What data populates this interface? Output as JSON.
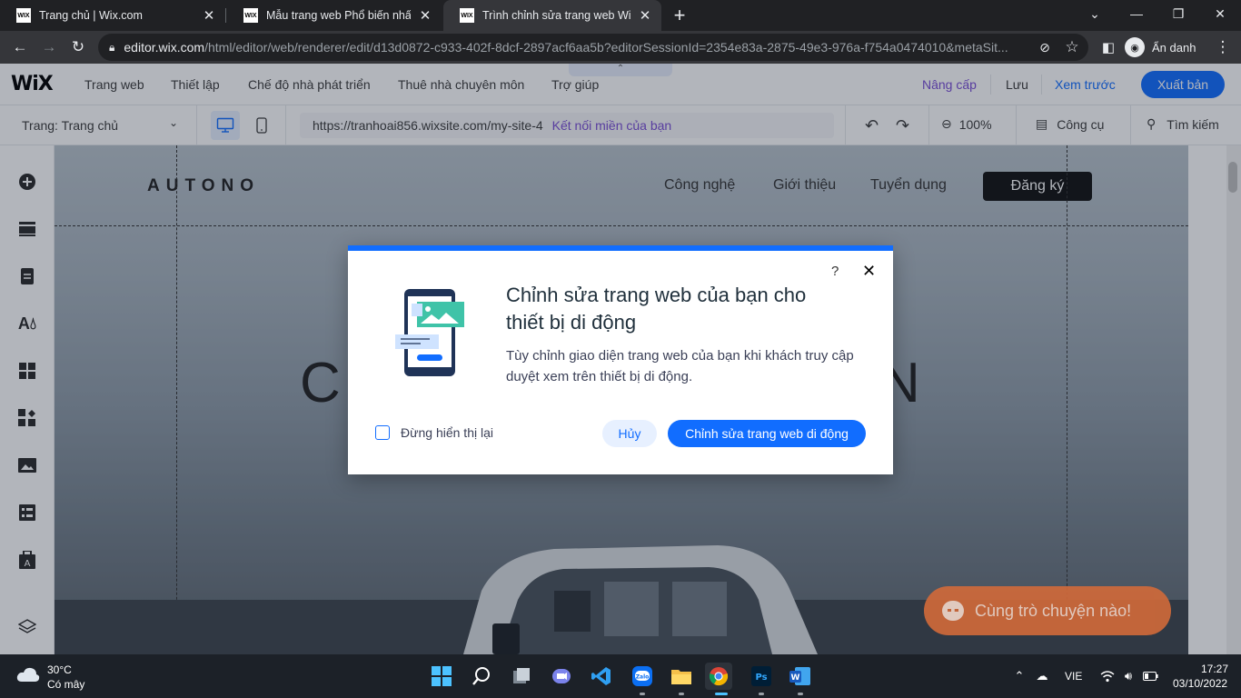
{
  "browser": {
    "tabs": [
      {
        "title": "Trang chủ | Wix.com",
        "active": false
      },
      {
        "title": "Mẫu trang web Phổ biến nhất | W",
        "active": false
      },
      {
        "title": "Trình chỉnh sửa trang web Wix | r",
        "active": true
      }
    ],
    "favicon_text": "WIX",
    "url_host": "editor.wix.com",
    "url_path": "/html/editor/web/renderer/edit/d13d0872-c933-402f-8dcf-2897acf6aa5b?editorSessionId=2354e83a-2875-49e3-976a-f754a0474010&metaSit...",
    "incognito_label": "Ẩn danh"
  },
  "wix": {
    "logo": "WiX",
    "menu": [
      "Trang web",
      "Thiết lập",
      "Chế độ nhà phát triển",
      "Thuê nhà chuyên môn",
      "Trợ giúp"
    ],
    "upgrade": "Nâng cấp",
    "save": "Lưu",
    "preview": "Xem trước",
    "publish": "Xuất bản",
    "page_select": "Trang: Trang chủ",
    "site_url": "https://tranhoai856.wixsite.com/my-site-4",
    "connect_domain": "Kết nối miền của bạn",
    "zoom": "100%",
    "tools": "Công cụ",
    "search": "Tìm kiếm"
  },
  "site": {
    "logo": "AUTONO",
    "nav": [
      "Công nghệ",
      "Giới thiệu",
      "Tuyển dụng"
    ],
    "signup": "Đăng ký",
    "hero_left": "C",
    "hero_right": "N",
    "chat": "Cùng trò chuyện nào!"
  },
  "modal": {
    "help": "?",
    "title": "Chỉnh sửa trang web của bạn cho thiết bị di động",
    "description": "Tùy chỉnh giao diện trang web của bạn khi khách truy cập duyệt xem trên thiết bị di động.",
    "checkbox_label": "Đừng hiển thị lại",
    "cancel": "Hủy",
    "confirm": "Chỉnh sửa trang web di động"
  },
  "taskbar": {
    "temperature": "30°C",
    "weather": "Có mây",
    "language": "VIE",
    "time": "17:27",
    "date": "03/10/2022"
  },
  "colors": {
    "accent": "#116dff",
    "upgrade": "#7a4dd6",
    "chat": "#d26a3a"
  }
}
